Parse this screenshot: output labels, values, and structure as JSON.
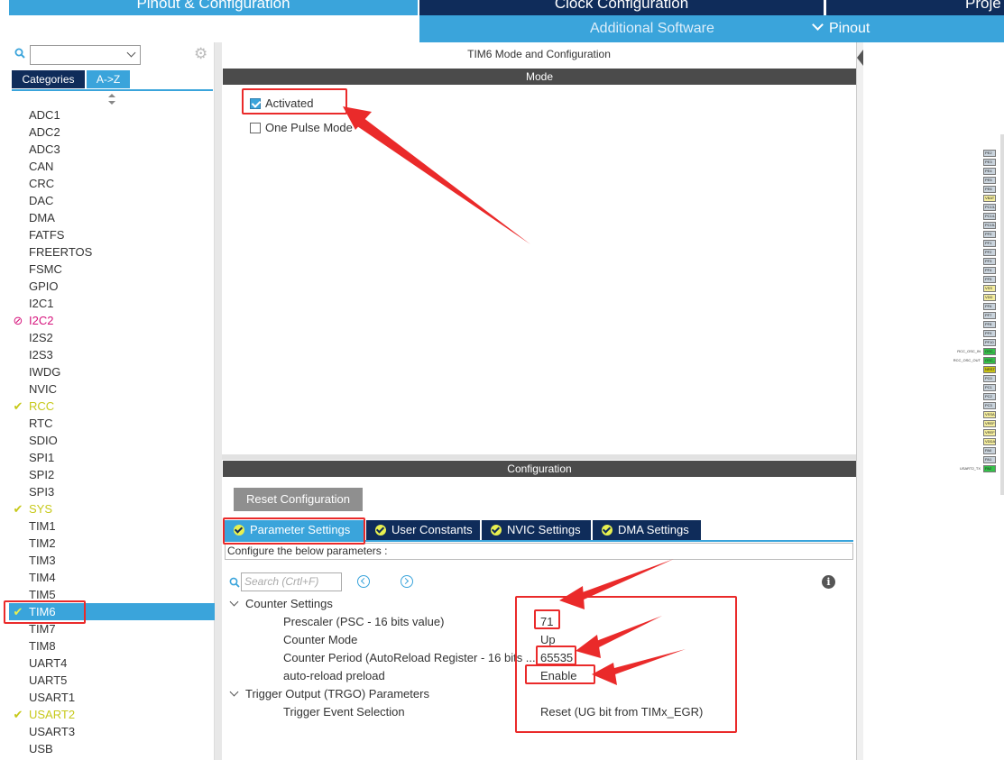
{
  "top_tabs": {
    "pinout_config": "Pinout & Configuration",
    "clock_config": "Clock Configuration",
    "project": "Proje"
  },
  "subbar": {
    "additional_software": "Additional Software",
    "pinout": "Pinout"
  },
  "left": {
    "search_value": "",
    "category_tabs": [
      "Categories",
      "A->Z"
    ],
    "active_category_tab": "A->Z",
    "items": [
      {
        "label": "ADC1",
        "status": "none"
      },
      {
        "label": "ADC2",
        "status": "none"
      },
      {
        "label": "ADC3",
        "status": "none"
      },
      {
        "label": "CAN",
        "status": "none"
      },
      {
        "label": "CRC",
        "status": "none"
      },
      {
        "label": "DAC",
        "status": "none"
      },
      {
        "label": "DMA",
        "status": "none"
      },
      {
        "label": "FATFS",
        "status": "none"
      },
      {
        "label": "FREERTOS",
        "status": "none"
      },
      {
        "label": "FSMC",
        "status": "none"
      },
      {
        "label": "GPIO",
        "status": "none"
      },
      {
        "label": "I2C1",
        "status": "none"
      },
      {
        "label": "I2C2",
        "status": "error"
      },
      {
        "label": "I2S2",
        "status": "none"
      },
      {
        "label": "I2S3",
        "status": "none"
      },
      {
        "label": "IWDG",
        "status": "none"
      },
      {
        "label": "NVIC",
        "status": "none"
      },
      {
        "label": "RCC",
        "status": "ok"
      },
      {
        "label": "RTC",
        "status": "none"
      },
      {
        "label": "SDIO",
        "status": "none"
      },
      {
        "label": "SPI1",
        "status": "none"
      },
      {
        "label": "SPI2",
        "status": "none"
      },
      {
        "label": "SPI3",
        "status": "none"
      },
      {
        "label": "SYS",
        "status": "ok"
      },
      {
        "label": "TIM1",
        "status": "none"
      },
      {
        "label": "TIM2",
        "status": "none"
      },
      {
        "label": "TIM3",
        "status": "none"
      },
      {
        "label": "TIM4",
        "status": "none"
      },
      {
        "label": "TIM5",
        "status": "none"
      },
      {
        "label": "TIM6",
        "status": "ok",
        "selected": true
      },
      {
        "label": "TIM7",
        "status": "none"
      },
      {
        "label": "TIM8",
        "status": "none"
      },
      {
        "label": "UART4",
        "status": "none"
      },
      {
        "label": "UART5",
        "status": "none"
      },
      {
        "label": "USART1",
        "status": "none"
      },
      {
        "label": "USART2",
        "status": "ok"
      },
      {
        "label": "USART3",
        "status": "none"
      },
      {
        "label": "USB",
        "status": "none"
      }
    ]
  },
  "center": {
    "title": "TIM6 Mode and Configuration",
    "mode_header": "Mode",
    "mode_options": [
      {
        "label": "Activated",
        "checked": true
      },
      {
        "label": "One Pulse Mode",
        "checked": false
      }
    ],
    "config_header": "Configuration",
    "reset_button": "Reset Configuration",
    "config_tabs": [
      "Parameter Settings",
      "User Constants",
      "NVIC Settings",
      "DMA Settings"
    ],
    "active_config_tab": "Parameter Settings",
    "config_description": "Configure the below parameters :",
    "param_search_placeholder": "Search (Crtl+F)",
    "parameters": [
      {
        "type": "group",
        "label": "Counter Settings"
      },
      {
        "type": "param",
        "name": "Prescaler (PSC - 16 bits value)",
        "value": "71"
      },
      {
        "type": "param",
        "name": "Counter Mode",
        "value": "Up"
      },
      {
        "type": "param",
        "name": "Counter Period (AutoReload Register - 16 bits ...",
        "value": "65535"
      },
      {
        "type": "param",
        "name": "auto-reload preload",
        "value": "Enable"
      },
      {
        "type": "group",
        "label": "Trigger Output (TRGO) Parameters"
      },
      {
        "type": "param",
        "name": "Trigger Event Selection",
        "value": "Reset (UG bit from TIMx_EGR)"
      }
    ]
  },
  "chip": {
    "pins": [
      {
        "label": "PE2",
        "color": "gray"
      },
      {
        "label": "PE3",
        "color": "gray"
      },
      {
        "label": "PE4",
        "color": "gray"
      },
      {
        "label": "PE5",
        "color": "gray"
      },
      {
        "label": "PE6",
        "color": "gray"
      },
      {
        "label": "VBAT",
        "color": "yellow"
      },
      {
        "label": "PC13-",
        "color": "gray"
      },
      {
        "label": "PC14-",
        "color": "gray"
      },
      {
        "label": "PC15-",
        "color": "gray"
      },
      {
        "label": "PF0",
        "color": "gray"
      },
      {
        "label": "PF1",
        "color": "gray"
      },
      {
        "label": "PF2",
        "color": "gray"
      },
      {
        "label": "PF3",
        "color": "gray"
      },
      {
        "label": "PF4",
        "color": "gray"
      },
      {
        "label": "PF5",
        "color": "gray"
      },
      {
        "label": "VSS",
        "color": "yellow"
      },
      {
        "label": "VDD",
        "color": "yellow"
      },
      {
        "label": "PF6",
        "color": "gray"
      },
      {
        "label": "PF7",
        "color": "gray"
      },
      {
        "label": "PF8",
        "color": "gray"
      },
      {
        "label": "PF9",
        "color": "gray"
      },
      {
        "label": "PF10",
        "color": "gray"
      },
      {
        "label": "OSC_IN",
        "color": "green"
      },
      {
        "label": "OSC_OUT",
        "color": "green"
      },
      {
        "label": "NRST",
        "color": "olive"
      },
      {
        "label": "PC0",
        "color": "gray"
      },
      {
        "label": "PC1",
        "color": "gray"
      },
      {
        "label": "PC2",
        "color": "gray"
      },
      {
        "label": "PC3",
        "color": "gray"
      },
      {
        "label": "VSSA",
        "color": "yellow"
      },
      {
        "label": "VREF-",
        "color": "yellow"
      },
      {
        "label": "VREF+",
        "color": "yellow"
      },
      {
        "label": "VDDA",
        "color": "yellow"
      },
      {
        "label": "PA0",
        "color": "gray"
      },
      {
        "label": "PA1",
        "color": "gray"
      },
      {
        "label": "PA2",
        "color": "green"
      }
    ],
    "signal_labels": [
      {
        "text": "RCC_OSC_IN",
        "pin_index": 22
      },
      {
        "text": "RCC_OSC_OUT",
        "pin_index": 23
      },
      {
        "text": "USART2_TX",
        "pin_index": 35
      }
    ]
  },
  "colors": {
    "accent_blue": "#3aa4db",
    "navy": "#0f2c5a",
    "ok_yellow": "#c7c91a",
    "error_magenta": "#d6137c",
    "annotation_red": "#ea2a2a"
  }
}
